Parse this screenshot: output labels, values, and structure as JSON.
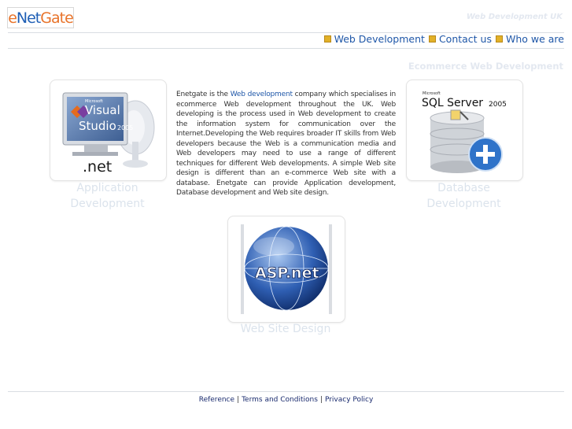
{
  "header": {
    "logo_part1": "e",
    "logo_part2": "Net",
    "logo_part3": "Gate",
    "tagline": "Web Development UK"
  },
  "nav": {
    "items": [
      {
        "label": "Web Development"
      },
      {
        "label": "Contact us"
      },
      {
        "label": "Who we are"
      }
    ]
  },
  "main": {
    "subheading": "Ecommerce Web Development",
    "cards": [
      {
        "caption_line1": "Application",
        "caption_line2": "Development",
        "image_label": "Visual Studio 2005 .net"
      },
      {
        "caption_line1": "Database",
        "caption_line2": "Development",
        "image_label": "SQL Server 2005"
      },
      {
        "caption_line1": "Web Site Design",
        "caption_line2": "",
        "image_label": "ASP.net"
      }
    ],
    "description": {
      "before_link": "Enetgate is the ",
      "link": "Web development",
      "after_link": " company which specialises in ecommerce Web development throughout the UK. Web developing is the process used in Web development to create the information system for communication over the Internet.Developing the Web requires broader IT skills from Web developers because the Web is a communication media and Web developers may need to use a range of different techniques for different Web developments. A simple Web site design is different than an e-commerce Web site with a database. Enetgate can provide Application development, Database development and Web site design."
    }
  },
  "images": {
    "vs_small": "Microsoft",
    "vs_line1": "Visual",
    "vs_line2": "Studio",
    "vs_year": "2005",
    "vs_net": ".net",
    "sql_small": "Microsoft",
    "sql_name": "SQL Server",
    "sql_year": "2005",
    "asp_text": "ASP.net"
  },
  "footer": {
    "links": [
      {
        "label": "Reference"
      },
      {
        "label": "Terms and Conditions"
      },
      {
        "label": "Privacy Policy"
      }
    ],
    "separator": "|"
  },
  "colors": {
    "link": "#1f57a8",
    "faded_text": "#dbe3ec",
    "bullet": "#e2b128"
  }
}
